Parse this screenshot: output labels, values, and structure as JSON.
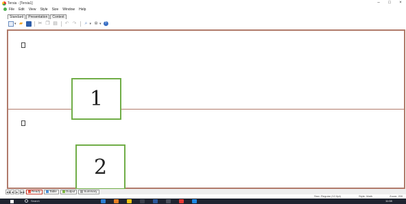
{
  "window": {
    "title": "Tersia - [Tersia1]",
    "controls": {
      "minimize": "–",
      "maximize": "□",
      "close": "×"
    }
  },
  "menu": {
    "icon": "app-mini-icon",
    "items": [
      "File",
      "Edit",
      "View",
      "Style",
      "Size",
      "Window",
      "Help"
    ]
  },
  "toolbar_tabs": [
    "Standard",
    "Presentation",
    "Context"
  ],
  "toolbar_icons": [
    "new-document-icon",
    "open-folder-icon",
    "save-icon",
    "cut-icon",
    "copy-icon",
    "paste-icon",
    "undo-icon",
    "redo-icon",
    "find-icon",
    "zoom-icon",
    "help-icon"
  ],
  "regions": [
    {
      "label": "1"
    },
    {
      "label": "2"
    }
  ],
  "sheet_nav": [
    "◀◀",
    "◀",
    "▶",
    "▶▶"
  ],
  "sheet_tabs": [
    {
      "label": "Ready",
      "active": true,
      "color": "#e74c3c"
    },
    {
      "label": "Table",
      "active": false,
      "color": "#4a90d9"
    },
    {
      "label": "Output",
      "active": false,
      "color": "#7cb342"
    },
    {
      "label": "Summary",
      "active": false,
      "color": "#9e9e9e"
    }
  ],
  "status": {
    "size": "Size: Regular (12.0pt)",
    "style": "Style: Math",
    "zoom": "Zoom: 200"
  },
  "taskbar": {
    "search_placeholder": "Search",
    "clock": "11:08"
  },
  "colors": {
    "region_border": "#b07a6a",
    "label_border": "#70ad47",
    "taskbar_bg": "#1f2430"
  }
}
